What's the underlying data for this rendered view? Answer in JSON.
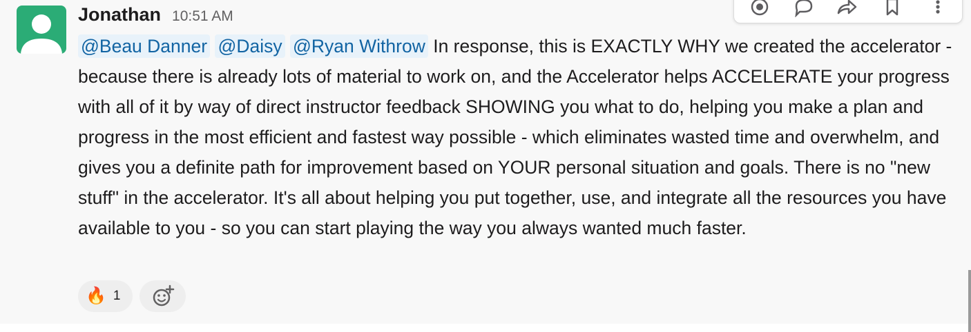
{
  "message": {
    "sender": "Jonathan",
    "timestamp": "10:51 AM",
    "mentions": [
      "@Beau Danner",
      "@Daisy",
      "@Ryan Withrow"
    ],
    "text": "In response, this is EXACTLY WHY we created the accelerator - because there is already lots of material to work on, and the Accelerator helps ACCELERATE your progress with all of it by way of direct instructor feedback SHOWING you what to do, helping you make a plan and progress in the most efficient and fastest way possible - which eliminates wasted time and overwhelm, and gives you a definite path for improvement based on YOUR personal situation and goals. There is no \"new stuff\" in the accelerator. It's all about helping you put together, use, and integrate all the resources you have available to you - so you can start playing the way you always wanted much faster."
  },
  "reactions": [
    {
      "emoji": "🔥",
      "count": "1"
    }
  ],
  "toolbar": {
    "icons": [
      "completed-icon",
      "reply-in-thread-icon",
      "share-icon",
      "bookmark-icon",
      "more-actions-icon"
    ]
  },
  "colors": {
    "avatar": "#2bac76",
    "mention_text": "#1264a3",
    "mention_bg": "#e8f2fa",
    "message_bg": "#f8f8f8",
    "reaction_bg": "#eeeeee"
  }
}
